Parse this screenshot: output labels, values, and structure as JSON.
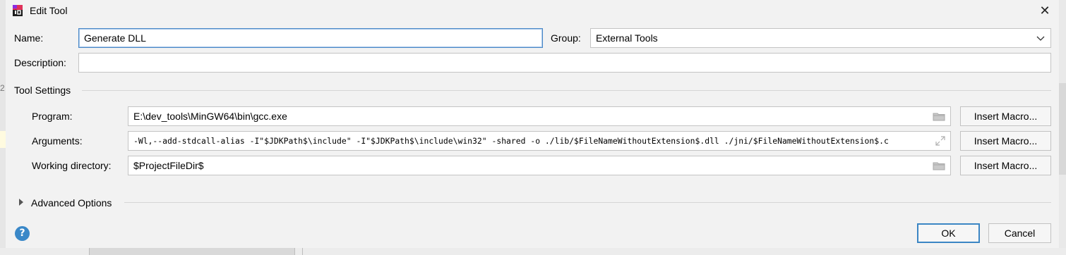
{
  "window": {
    "title": "Edit Tool",
    "close_symbol": "✕"
  },
  "background": {
    "left_mark": "2"
  },
  "form": {
    "name_label": "Name:",
    "name_value": "Generate DLL",
    "group_label": "Group:",
    "group_value": "External Tools",
    "description_label": "Description:",
    "description_value": ""
  },
  "tool_settings": {
    "section_label": "Tool Settings",
    "program_label": "Program:",
    "program_value": "E:\\dev_tools\\MinGW64\\bin\\gcc.exe",
    "arguments_label": "Arguments:",
    "arguments_value": "-Wl,--add-stdcall-alias -I\"$JDKPath$\\include\" -I\"$JDKPath$\\include\\win32\" -shared -o ./lib/$FileNameWithoutExtension$.dll ./jni/$FileNameWithoutExtension$.c",
    "working_dir_label": "Working directory:",
    "working_dir_value": "$ProjectFileDir$",
    "insert_macro_label": "Insert Macro..."
  },
  "advanced": {
    "label": "Advanced Options"
  },
  "footer": {
    "help_symbol": "?",
    "ok_label": "OK",
    "cancel_label": "Cancel"
  },
  "icons": [
    "app-icon",
    "close-icon",
    "chevron-down-icon",
    "folder-icon",
    "expand-icon",
    "expand-triangle-icon",
    "help-icon"
  ],
  "colors": {
    "accent": "#3b86c4",
    "help_bg": "#3a88c8",
    "dialog_bg": "#f2f2f2"
  }
}
